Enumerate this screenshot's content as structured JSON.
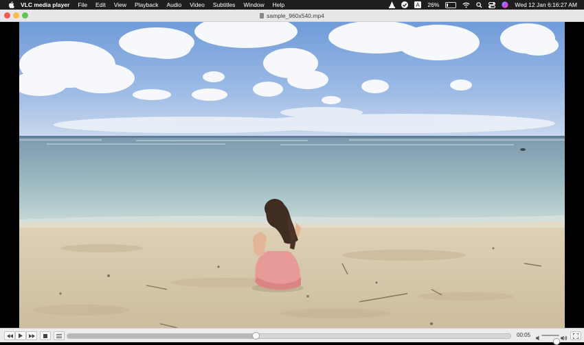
{
  "menubar": {
    "app_name": "VLC media player",
    "items": [
      "File",
      "Edit",
      "View",
      "Playback",
      "Audio",
      "Video",
      "Subtitles",
      "Window",
      "Help"
    ],
    "battery_percent": "26%",
    "battery_level": 0.26,
    "datetime": "Wed 12 Jan  6:16:27 AM"
  },
  "window": {
    "title": "sample_960x540.mp4"
  },
  "player": {
    "elapsed": "00:05",
    "progress": 0.425,
    "volume": 0.8
  },
  "icons": {
    "menubar": [
      "apple-icon",
      "vlc-icon",
      "checkmark-circle-icon",
      "text-input-icon",
      "battery-icon",
      "wifi-icon",
      "search-icon",
      "control-center-icon",
      "siri-icon"
    ],
    "controls": [
      "rewind-icon",
      "play-icon",
      "fast-forward-icon",
      "stop-icon",
      "playlist-icon",
      "volume-low-icon",
      "volume-high-icon",
      "fullscreen-icon"
    ]
  }
}
